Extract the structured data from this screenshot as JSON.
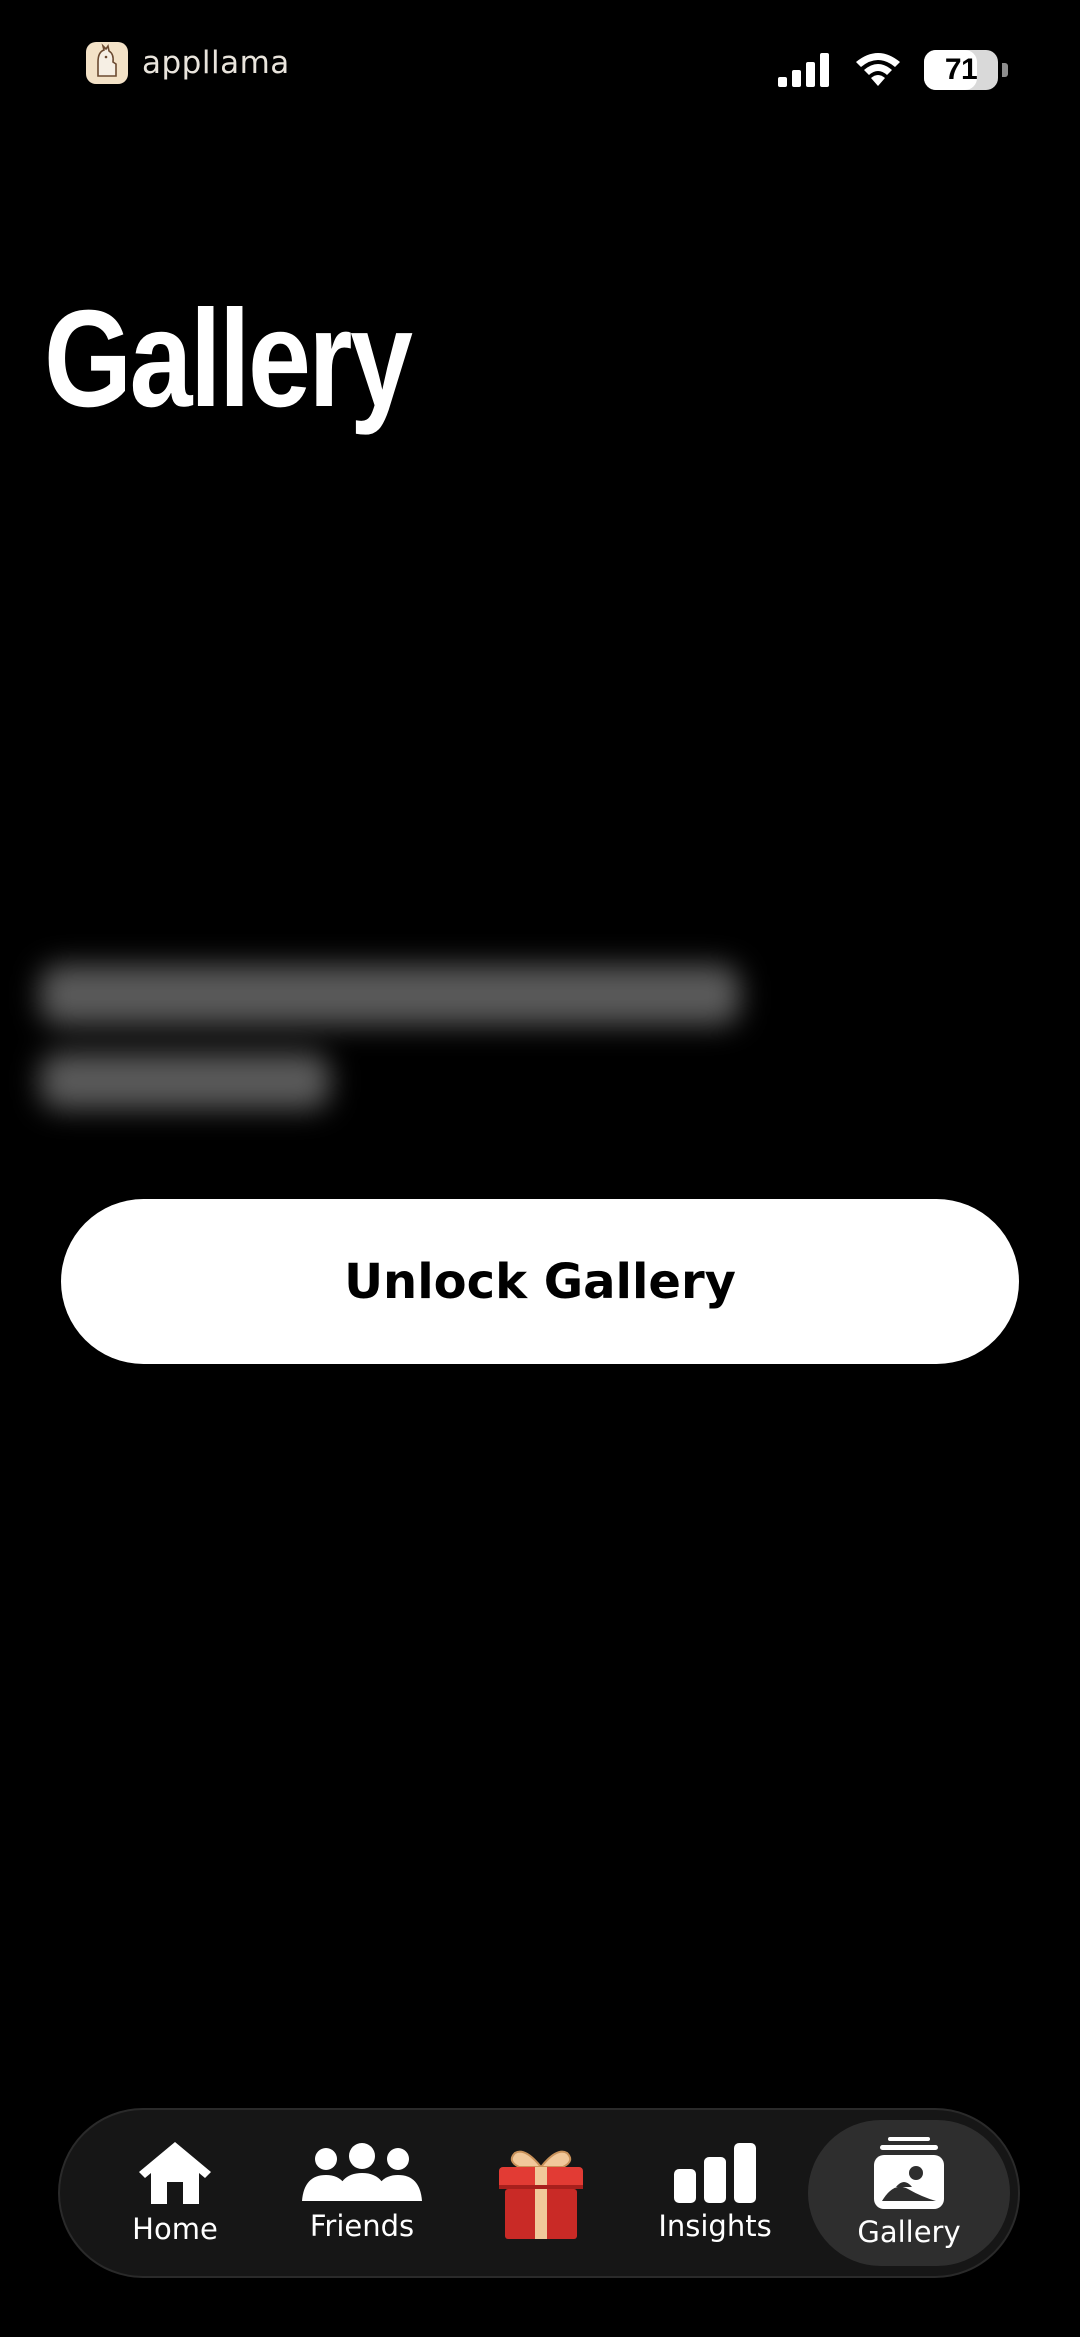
{
  "status_bar": {
    "app_name": "appllama",
    "battery_level": "71",
    "battery_fraction": 0.71,
    "signal_icon": "cellular-signal-icon",
    "wifi_icon": "wifi-icon"
  },
  "page": {
    "title": "Gallery"
  },
  "unlock_button": {
    "label": "Unlock Gallery"
  },
  "tab_bar": {
    "tabs": [
      {
        "label": "Home",
        "icon": "home-icon",
        "active": false
      },
      {
        "label": "Friends",
        "icon": "friends-icon",
        "active": false
      },
      {
        "label": "",
        "icon": "gift-icon",
        "active": false
      },
      {
        "label": "Insights",
        "icon": "insights-bar-chart-icon",
        "active": false
      },
      {
        "label": "Gallery",
        "icon": "gallery-icon",
        "active": true
      }
    ]
  },
  "colors": {
    "background": "#000000",
    "button_background": "#ffffff",
    "tab_bar_background": "#161616",
    "active_tab_background": "#2e2e2e",
    "gift_red": "#d8322e",
    "gift_ribbon": "#f1c89a"
  }
}
